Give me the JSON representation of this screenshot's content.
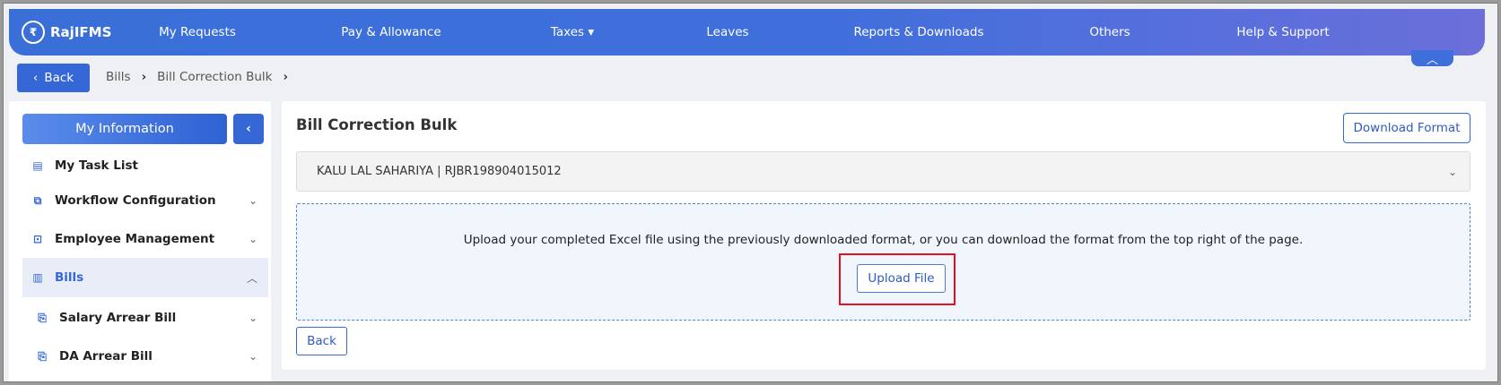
{
  "topnav": {
    "brand": "RajIFMS",
    "items": [
      {
        "label": "My Requests"
      },
      {
        "label": "Pay & Allowance"
      },
      {
        "label": "Taxes ▾"
      },
      {
        "label": "Leaves"
      },
      {
        "label": "Reports & Downloads"
      },
      {
        "label": "Others"
      },
      {
        "label": "Help & Support"
      }
    ]
  },
  "breadcrumb": {
    "back_label": "Back",
    "crumbs": [
      "Bills",
      "Bill Correction Bulk"
    ]
  },
  "sidebar": {
    "header": "My Information",
    "items": [
      {
        "label": "My Task List",
        "icon": "list-icon"
      },
      {
        "label": "Workflow Configuration",
        "icon": "workflow-icon"
      },
      {
        "label": "Employee Management",
        "icon": "briefcase-icon"
      },
      {
        "label": "Bills",
        "icon": "bill-icon",
        "active": true
      },
      {
        "label": "Salary Arrear Bill",
        "icon": "document-search-icon"
      },
      {
        "label": "DA Arrear Bill",
        "icon": "document-search-icon"
      }
    ]
  },
  "main": {
    "title": "Bill Correction Bulk",
    "download_label": "Download Format",
    "employee": "KALU LAL SAHARIYA | RJBR198904015012",
    "instructions": "Upload your completed Excel file using the previously downloaded format, or you can download the format from the top right of the page.",
    "upload_label": "Upload File",
    "back_label": "Back"
  },
  "colors": {
    "primary": "#3567d6",
    "highlight": "#e3121b"
  }
}
